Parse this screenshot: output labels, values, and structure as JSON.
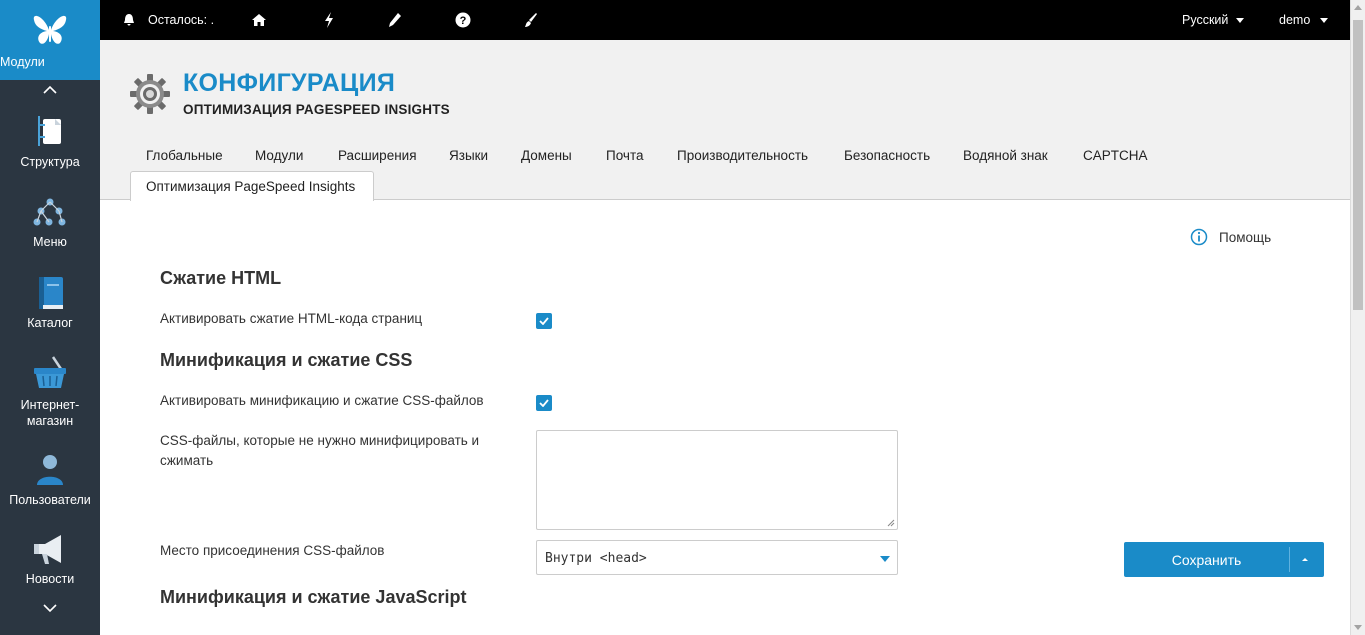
{
  "sidebar": {
    "items": [
      {
        "label": "Модули",
        "icon": "butterfly-icon",
        "active": true
      },
      {
        "label": "Структура",
        "icon": "structure-icon"
      },
      {
        "label": "Меню",
        "icon": "menu-tree-icon"
      },
      {
        "label": "Каталог",
        "icon": "book-icon"
      },
      {
        "label": "Интернет-магазин",
        "icon": "basket-icon"
      },
      {
        "label": "Пользователи",
        "icon": "user-icon"
      },
      {
        "label": "Новости",
        "icon": "megaphone-icon"
      }
    ]
  },
  "topbar": {
    "remaining": "Осталось: .",
    "language": "Русский",
    "user": "demo"
  },
  "header": {
    "title": "КОНФИГУРАЦИЯ",
    "subtitle": "ОПТИМИЗАЦИЯ PAGESPEED INSIGHTS"
  },
  "tabs": [
    "Глобальные",
    "Модули",
    "Расширения",
    "Языки",
    "Домены",
    "Почта",
    "Производительность",
    "Безопасность",
    "Водяной знак",
    "CAPTCHA"
  ],
  "active_tab": "Оптимизация PageSpeed Insights",
  "help_label": "Помощь",
  "form": {
    "html_section": "Сжатие HTML",
    "html_enable_label": "Активировать сжатие HTML-кода страниц",
    "html_enable_checked": true,
    "css_section": "Минификация и сжатие CSS",
    "css_enable_label": "Активировать минификацию и сжатие CSS-файлов",
    "css_enable_checked": true,
    "css_exclude_label_1": "CSS-файлы, которые не нужно минифицировать и",
    "css_exclude_label_2": "сжимать",
    "css_exclude_value": "",
    "css_place_label": "Место присоединения CSS-файлов",
    "css_place_value": "Внутри <head>",
    "js_section": "Минификация и сжатие JavaScript"
  },
  "save_label": "Сохранить",
  "colors": {
    "accent": "#1a8bc8",
    "sidebar": "#2b3641",
    "topbar": "#000000"
  }
}
